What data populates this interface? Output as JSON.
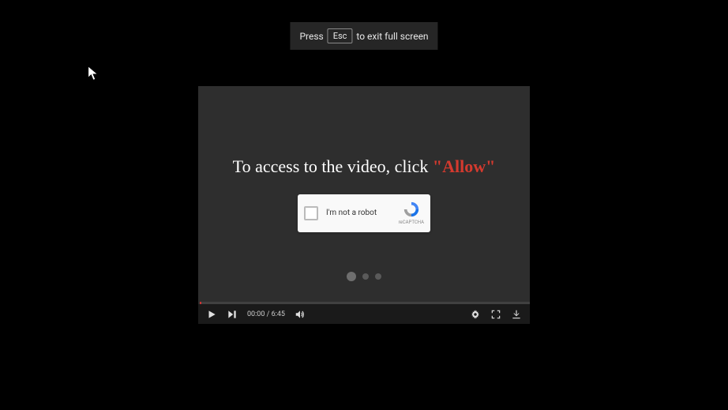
{
  "fullscreen_hint": {
    "press_label": "Press",
    "esc_key": "Esc",
    "exit_label": "to exit full screen"
  },
  "video": {
    "access_prefix": "To access to the video, click ",
    "allow_text": "\"Allow\"",
    "recaptcha_label": "I'm not a robot",
    "recaptcha_brand": "reCAPTCHA",
    "time_current": "00:00",
    "time_separator": " / ",
    "time_total": "6:45"
  }
}
